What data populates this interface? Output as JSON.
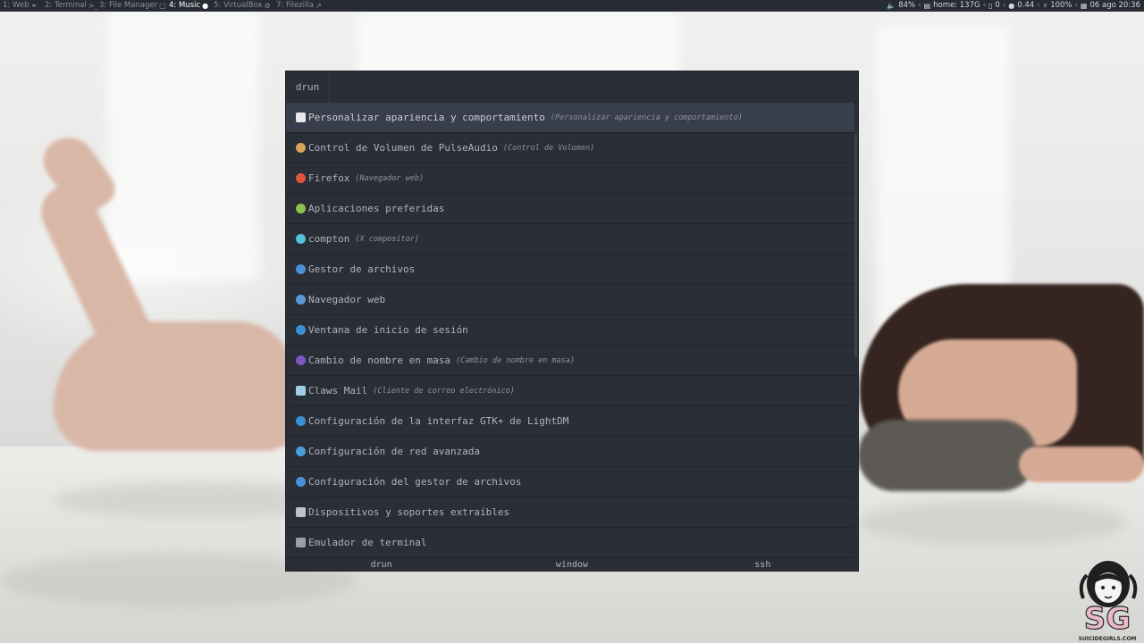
{
  "topbar": {
    "workspaces": [
      {
        "label": "1: Web",
        "icon": "firefox-icon",
        "active": false
      },
      {
        "label": "2: Terminal",
        "icon": "terminal-icon",
        "active": false
      },
      {
        "label": "3: File Manager",
        "icon": "folder-icon",
        "active": false
      },
      {
        "label": "4: Music",
        "icon": "music-icon",
        "active": true
      },
      {
        "label": "5: VirtualBox",
        "icon": "cogs-icon",
        "active": false
      },
      {
        "label": "7: Filezilla",
        "icon": "external-link-icon",
        "active": false
      }
    ],
    "status": {
      "volume": "84%",
      "disk": "home: 137G",
      "trash": "0",
      "load": "0.44",
      "battery": "100%",
      "datetime": "06 ago 20:36"
    }
  },
  "rofi": {
    "prompt": "drun",
    "entries": [
      {
        "name": "Personalizar apariencia y comportamiento",
        "desc": "(Personalizar apariencia y comportamiento)",
        "icon": "appearance-icon",
        "color": "#e8e8e8",
        "selected": true
      },
      {
        "name": "Control de Volumen de PulseAudio",
        "desc": "(Control de Volumen)",
        "icon": "pulseaudio-icon",
        "color": "#d9a45b"
      },
      {
        "name": "Firefox",
        "desc": "(Navegador web)",
        "icon": "firefox-icon",
        "color": "#e0553a"
      },
      {
        "name": "Aplicaciones preferidas",
        "desc": "",
        "icon": "preferred-apps-icon",
        "color": "#8bc34a"
      },
      {
        "name": "compton",
        "desc": "(X compositor)",
        "icon": "compton-gear-icon",
        "color": "#4fc3d9"
      },
      {
        "name": "Gestor de archivos",
        "desc": "",
        "icon": "file-manager-icon",
        "color": "#4a90d9"
      },
      {
        "name": "Navegador web",
        "desc": "",
        "icon": "web-browser-icon",
        "color": "#5b9bd5"
      },
      {
        "name": "Ventana de inicio de sesión",
        "desc": "",
        "icon": "login-window-icon",
        "color": "#3b8fd4"
      },
      {
        "name": "Cambio de nombre en masa",
        "desc": "(Cambio de nombre en masa)",
        "icon": "bulk-rename-icon",
        "color": "#7e57c2"
      },
      {
        "name": "Claws Mail",
        "desc": "(Cliente de correo electrónico)",
        "icon": "mail-icon",
        "color": "#9ecfe6"
      },
      {
        "name": "Configuración de la interfaz GTK+ de LightDM",
        "desc": "",
        "icon": "lightdm-icon",
        "color": "#3b8fd4"
      },
      {
        "name": "Configuración de red avanzada",
        "desc": "",
        "icon": "network-icon",
        "color": "#4a9fd9"
      },
      {
        "name": "Configuración del gestor de archivos",
        "desc": "",
        "icon": "file-manager-settings-icon",
        "color": "#4a90d9"
      },
      {
        "name": "Dispositivos y soportes extraíbles",
        "desc": "",
        "icon": "removable-drive-icon",
        "color": "#bfc3c9"
      },
      {
        "name": "Emulador de terminal",
        "desc": "",
        "icon": "terminal-icon",
        "color": "#9aa0a8"
      }
    ],
    "modes": [
      "drun",
      "window",
      "ssh"
    ]
  },
  "watermark": {
    "text": "SG",
    "subtext": "SUICIDEGIRLS.COM"
  }
}
